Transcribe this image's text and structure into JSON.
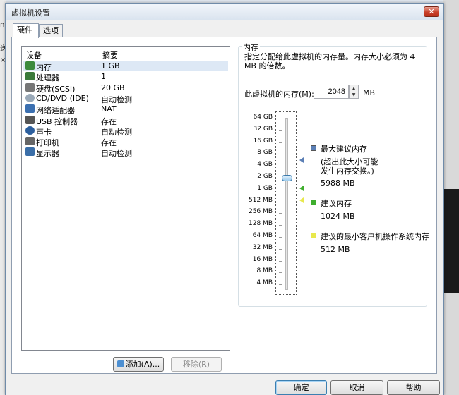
{
  "window": {
    "title": "虚拟机设置"
  },
  "tabs": [
    {
      "label": "硬件"
    },
    {
      "label": "选项"
    }
  ],
  "device_list": {
    "columns": {
      "device": "设备",
      "summary": "摘要"
    },
    "rows": [
      {
        "name": "内存",
        "summary": "1 GB",
        "icon": "memory-icon",
        "selected": true
      },
      {
        "name": "处理器",
        "summary": "1",
        "icon": "processor-icon"
      },
      {
        "name": "硬盘(SCSI)",
        "summary": "20 GB",
        "icon": "hard-disk-icon"
      },
      {
        "name": "CD/DVD (IDE)",
        "summary": "自动检测",
        "icon": "cd-dvd-icon"
      },
      {
        "name": "网络适配器",
        "summary": "NAT",
        "icon": "network-adapter-icon"
      },
      {
        "name": "USB 控制器",
        "summary": "存在",
        "icon": "usb-icon"
      },
      {
        "name": "声卡",
        "summary": "自动检测",
        "icon": "sound-card-icon"
      },
      {
        "name": "打印机",
        "summary": "存在",
        "icon": "printer-icon"
      },
      {
        "name": "显示器",
        "summary": "自动检测",
        "icon": "display-icon"
      }
    ],
    "add_button": "添加(A)...",
    "remove_button": "移除(R)"
  },
  "memory": {
    "group_title": "内存",
    "description": "指定分配给此虚拟机的内存量。内存大小必须为 4 MB 的倍数。",
    "field_label": "此虚拟机的内存(M):",
    "value": "2048",
    "unit": "MB",
    "scale": [
      "64 GB",
      "32 GB",
      "16 GB",
      "8 GB",
      "4 GB",
      "2 GB",
      "1 GB",
      "512 MB",
      "256 MB",
      "128 MB",
      "64 MB",
      "32 MB",
      "16 MB",
      "8 MB",
      "4 MB"
    ],
    "legend": {
      "max": {
        "title": "最大建议内存",
        "note": "(超出此大小可能发生内存交换。)",
        "value": "5988 MB",
        "color": "#5b7fb5"
      },
      "recommended": {
        "title": "建议内存",
        "value": "1024 MB",
        "color": "#3fae2e"
      },
      "minimum": {
        "title": "建议的最小客户机操作系统内存",
        "value": "512 MB",
        "color": "#e8e84c"
      }
    }
  },
  "footer": {
    "ok": "确定",
    "cancel": "取消",
    "help": "帮助"
  }
}
